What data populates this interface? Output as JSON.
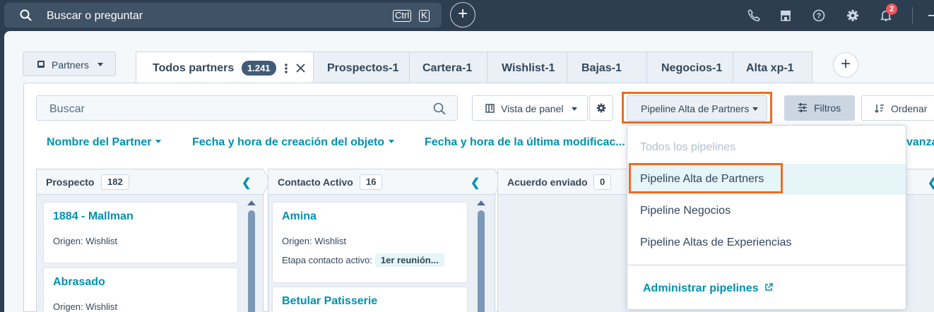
{
  "topbar": {
    "search_placeholder": "Buscar o preguntar",
    "shortcut_keys": [
      "Ctrl",
      "K"
    ],
    "notification_count": "2"
  },
  "object_selector": {
    "label": "Partners"
  },
  "tabs": [
    {
      "label": "Todos partners",
      "count": "1.241",
      "active": true
    },
    {
      "label": "Prospectos-1"
    },
    {
      "label": "Cartera-1"
    },
    {
      "label": "Wishlist-1"
    },
    {
      "label": "Bajas-1"
    },
    {
      "label": "Negocios-1"
    },
    {
      "label": "Alta xp-1"
    }
  ],
  "toolbar": {
    "search_placeholder": "Buscar",
    "view_label": "Vista de panel",
    "pipeline_label": "Pipeline Alta de Partners",
    "filters_label": "Filtros",
    "sort_label": "Ordenar"
  },
  "sort_fields": [
    "Nombre del Partner",
    "Fecha y hora de creación del objeto",
    "Fecha y hora de la última modificac...",
    "vanza"
  ],
  "board": {
    "columns": [
      {
        "name": "Prospecto",
        "count": "182",
        "cards": [
          {
            "title": "1884 - Mallman",
            "lines": [
              "Origen: Wishlist"
            ]
          },
          {
            "title": "Abrasado",
            "lines": [
              "Origen: Wishlist"
            ]
          }
        ]
      },
      {
        "name": "Contacto Activo",
        "count": "16",
        "cards": [
          {
            "title": "Amina",
            "lines": [
              "Origen: Wishlist",
              "Etapa contacto activo:"
            ],
            "tag": "1er reunión..."
          },
          {
            "title": "Betular Patisserie",
            "lines": []
          }
        ]
      },
      {
        "name": "Acuerdo enviado",
        "count": "0",
        "cards": []
      }
    ]
  },
  "pipeline_dropdown": {
    "options": [
      {
        "label": "Todos los pipelines",
        "disabled": true
      },
      {
        "label": "Pipeline Alta de Partners",
        "selected": true
      },
      {
        "label": "Pipeline Negocios"
      },
      {
        "label": "Pipeline Altas de Experiencias"
      }
    ],
    "manage_link": "Administrar pipelines"
  },
  "colors": {
    "nav_bg": "#2d3e50",
    "link": "#0091ae",
    "highlight": "#f06b1f",
    "badge": "#f2545b"
  }
}
